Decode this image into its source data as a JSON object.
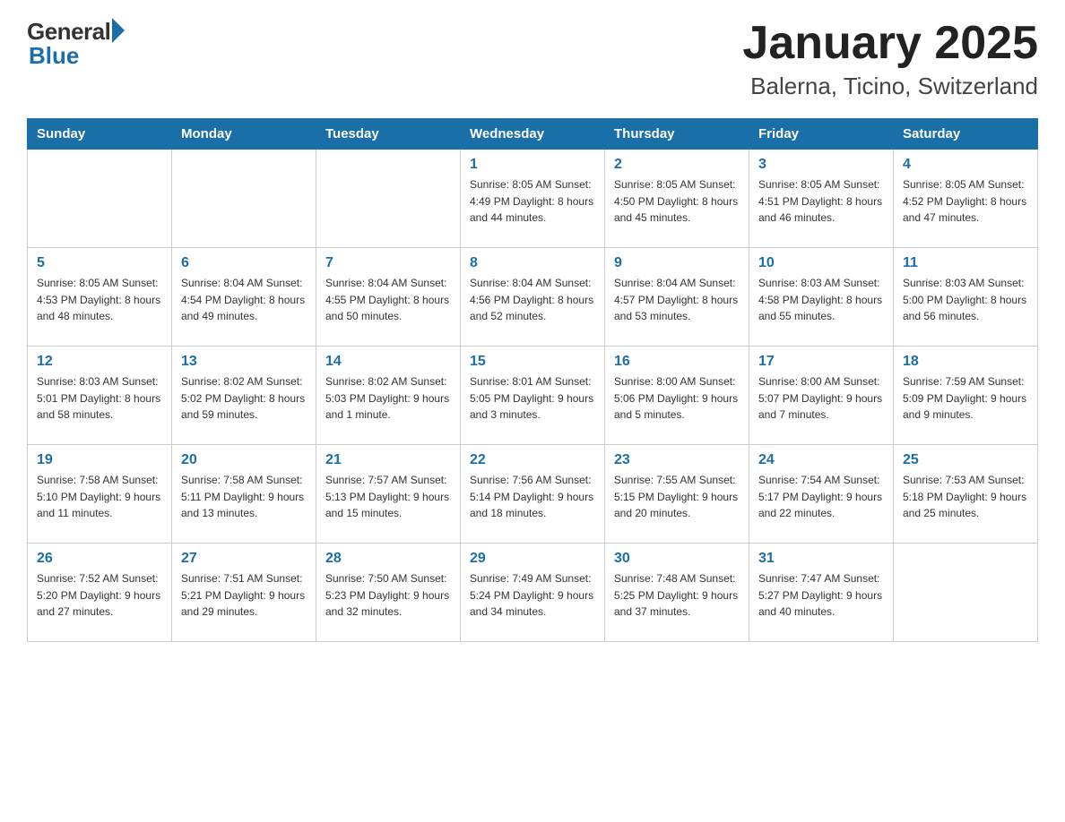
{
  "logo": {
    "general": "General",
    "blue": "Blue"
  },
  "title": "January 2025",
  "subtitle": "Balerna, Ticino, Switzerland",
  "headers": [
    "Sunday",
    "Monday",
    "Tuesday",
    "Wednesday",
    "Thursday",
    "Friday",
    "Saturday"
  ],
  "weeks": [
    [
      {
        "day": "",
        "info": ""
      },
      {
        "day": "",
        "info": ""
      },
      {
        "day": "",
        "info": ""
      },
      {
        "day": "1",
        "info": "Sunrise: 8:05 AM\nSunset: 4:49 PM\nDaylight: 8 hours\nand 44 minutes."
      },
      {
        "day": "2",
        "info": "Sunrise: 8:05 AM\nSunset: 4:50 PM\nDaylight: 8 hours\nand 45 minutes."
      },
      {
        "day": "3",
        "info": "Sunrise: 8:05 AM\nSunset: 4:51 PM\nDaylight: 8 hours\nand 46 minutes."
      },
      {
        "day": "4",
        "info": "Sunrise: 8:05 AM\nSunset: 4:52 PM\nDaylight: 8 hours\nand 47 minutes."
      }
    ],
    [
      {
        "day": "5",
        "info": "Sunrise: 8:05 AM\nSunset: 4:53 PM\nDaylight: 8 hours\nand 48 minutes."
      },
      {
        "day": "6",
        "info": "Sunrise: 8:04 AM\nSunset: 4:54 PM\nDaylight: 8 hours\nand 49 minutes."
      },
      {
        "day": "7",
        "info": "Sunrise: 8:04 AM\nSunset: 4:55 PM\nDaylight: 8 hours\nand 50 minutes."
      },
      {
        "day": "8",
        "info": "Sunrise: 8:04 AM\nSunset: 4:56 PM\nDaylight: 8 hours\nand 52 minutes."
      },
      {
        "day": "9",
        "info": "Sunrise: 8:04 AM\nSunset: 4:57 PM\nDaylight: 8 hours\nand 53 minutes."
      },
      {
        "day": "10",
        "info": "Sunrise: 8:03 AM\nSunset: 4:58 PM\nDaylight: 8 hours\nand 55 minutes."
      },
      {
        "day": "11",
        "info": "Sunrise: 8:03 AM\nSunset: 5:00 PM\nDaylight: 8 hours\nand 56 minutes."
      }
    ],
    [
      {
        "day": "12",
        "info": "Sunrise: 8:03 AM\nSunset: 5:01 PM\nDaylight: 8 hours\nand 58 minutes."
      },
      {
        "day": "13",
        "info": "Sunrise: 8:02 AM\nSunset: 5:02 PM\nDaylight: 8 hours\nand 59 minutes."
      },
      {
        "day": "14",
        "info": "Sunrise: 8:02 AM\nSunset: 5:03 PM\nDaylight: 9 hours\nand 1 minute."
      },
      {
        "day": "15",
        "info": "Sunrise: 8:01 AM\nSunset: 5:05 PM\nDaylight: 9 hours\nand 3 minutes."
      },
      {
        "day": "16",
        "info": "Sunrise: 8:00 AM\nSunset: 5:06 PM\nDaylight: 9 hours\nand 5 minutes."
      },
      {
        "day": "17",
        "info": "Sunrise: 8:00 AM\nSunset: 5:07 PM\nDaylight: 9 hours\nand 7 minutes."
      },
      {
        "day": "18",
        "info": "Sunrise: 7:59 AM\nSunset: 5:09 PM\nDaylight: 9 hours\nand 9 minutes."
      }
    ],
    [
      {
        "day": "19",
        "info": "Sunrise: 7:58 AM\nSunset: 5:10 PM\nDaylight: 9 hours\nand 11 minutes."
      },
      {
        "day": "20",
        "info": "Sunrise: 7:58 AM\nSunset: 5:11 PM\nDaylight: 9 hours\nand 13 minutes."
      },
      {
        "day": "21",
        "info": "Sunrise: 7:57 AM\nSunset: 5:13 PM\nDaylight: 9 hours\nand 15 minutes."
      },
      {
        "day": "22",
        "info": "Sunrise: 7:56 AM\nSunset: 5:14 PM\nDaylight: 9 hours\nand 18 minutes."
      },
      {
        "day": "23",
        "info": "Sunrise: 7:55 AM\nSunset: 5:15 PM\nDaylight: 9 hours\nand 20 minutes."
      },
      {
        "day": "24",
        "info": "Sunrise: 7:54 AM\nSunset: 5:17 PM\nDaylight: 9 hours\nand 22 minutes."
      },
      {
        "day": "25",
        "info": "Sunrise: 7:53 AM\nSunset: 5:18 PM\nDaylight: 9 hours\nand 25 minutes."
      }
    ],
    [
      {
        "day": "26",
        "info": "Sunrise: 7:52 AM\nSunset: 5:20 PM\nDaylight: 9 hours\nand 27 minutes."
      },
      {
        "day": "27",
        "info": "Sunrise: 7:51 AM\nSunset: 5:21 PM\nDaylight: 9 hours\nand 29 minutes."
      },
      {
        "day": "28",
        "info": "Sunrise: 7:50 AM\nSunset: 5:23 PM\nDaylight: 9 hours\nand 32 minutes."
      },
      {
        "day": "29",
        "info": "Sunrise: 7:49 AM\nSunset: 5:24 PM\nDaylight: 9 hours\nand 34 minutes."
      },
      {
        "day": "30",
        "info": "Sunrise: 7:48 AM\nSunset: 5:25 PM\nDaylight: 9 hours\nand 37 minutes."
      },
      {
        "day": "31",
        "info": "Sunrise: 7:47 AM\nSunset: 5:27 PM\nDaylight: 9 hours\nand 40 minutes."
      },
      {
        "day": "",
        "info": ""
      }
    ]
  ]
}
